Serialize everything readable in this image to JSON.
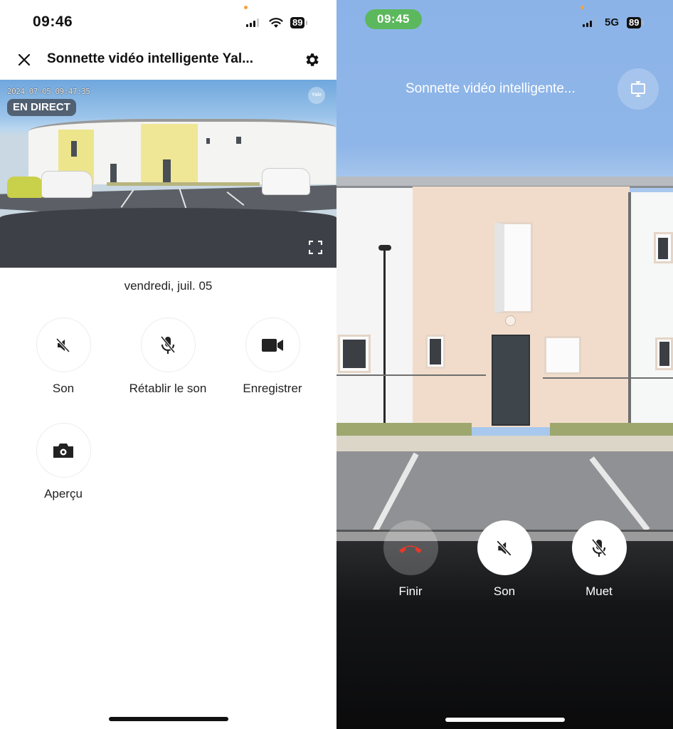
{
  "left_screen": {
    "status_bar": {
      "time": "09:46",
      "battery": "89",
      "signal_bars_active": 3,
      "signal_bars_total": 4,
      "connection": "wifi"
    },
    "app_bar": {
      "close_icon": "close-icon",
      "title": "Sonnette vidéo intelligente Yal...",
      "settings_icon": "gear-icon"
    },
    "video": {
      "timestamp": "2024-07-05 09:47:35",
      "live_badge": "EN DIRECT",
      "watermark": "Yale",
      "fullscreen_icon": "fullscreen-icon"
    },
    "date": "vendredi, juil. 05",
    "actions": [
      {
        "label": "Son",
        "icon": "speaker-muted-icon"
      },
      {
        "label": "Rétablir le son",
        "icon": "microphone-muted-icon"
      },
      {
        "label": "Enregistrer",
        "icon": "video-camera-icon"
      },
      {
        "label": "Aperçu",
        "icon": "camera-icon"
      }
    ]
  },
  "right_screen": {
    "status_bar": {
      "time": "09:45",
      "network": "5G",
      "battery": "89",
      "time_pill_color": "#5cb85c"
    },
    "title": "Sonnette vidéo intelligente...",
    "cast_icon": "screen-cast-icon",
    "call_controls": [
      {
        "label": "Finir",
        "icon": "hang-up-icon",
        "color": "#e8382b"
      },
      {
        "label": "Son",
        "icon": "speaker-muted-icon"
      },
      {
        "label": "Muet",
        "icon": "microphone-muted-icon"
      }
    ]
  },
  "colors": {
    "end_call_red": "#e8382b",
    "status_dot": "#f5a23c",
    "text_dark": "#111111"
  }
}
